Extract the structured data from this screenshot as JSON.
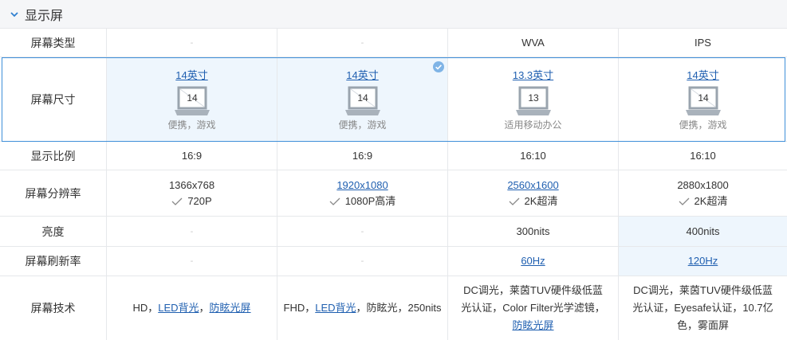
{
  "section": {
    "title": "显示屏"
  },
  "rows": {
    "panel_type": {
      "label": "屏幕类型",
      "values": [
        "-",
        "-",
        "WVA",
        "IPS"
      ]
    },
    "screen_size": {
      "label": "屏幕尺寸",
      "items": [
        {
          "link": "14英寸",
          "number": "14",
          "note": "便携，游戏"
        },
        {
          "link": "14英寸",
          "number": "14",
          "note": "便携，游戏"
        },
        {
          "link": "13.3英寸",
          "number": "13",
          "note": "适用移动办公"
        },
        {
          "link": "14英寸",
          "number": "14",
          "note": "便携，游戏"
        }
      ]
    },
    "aspect_ratio": {
      "label": "显示比例",
      "values": [
        "16:9",
        "16:9",
        "16:10",
        "16:10"
      ]
    },
    "resolution": {
      "label": "屏幕分辨率",
      "items": [
        {
          "value": "1366x768",
          "tag": "720P"
        },
        {
          "value": "1920x1080",
          "tag": "1080P高清"
        },
        {
          "value": "2560x1600",
          "tag": "2K超清"
        },
        {
          "value": "2880x1800",
          "tag": "2K超清"
        }
      ]
    },
    "brightness": {
      "label": "亮度",
      "values": [
        "-",
        "-",
        "300nits",
        "400nits"
      ]
    },
    "refresh_rate": {
      "label": "屏幕刷新率",
      "values": [
        "-",
        "-",
        "60Hz",
        "120Hz"
      ]
    },
    "technology": {
      "label": "屏幕技术",
      "col1": {
        "t1": "HD，",
        "l1": "LED背光",
        "t2": "，",
        "l2": "防眩光屏"
      },
      "col2": {
        "t1": "FHD，",
        "l1": "LED背光",
        "t2": "，防眩光，250nits"
      },
      "col3": {
        "t1": "DC调光，莱茵TUV硬件级低蓝光认证，Color Filter光学滤镜，",
        "l1": "防眩光屏"
      },
      "col4": {
        "t1": "DC调光，莱茵TUV硬件级低蓝光认证，Eyesafe认证，10.7亿色，雾面屏"
      }
    }
  }
}
